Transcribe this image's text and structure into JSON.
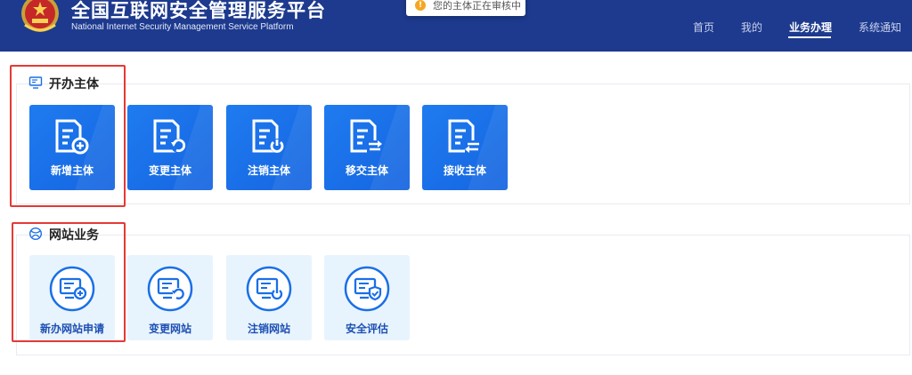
{
  "header": {
    "title": "全国互联网安全管理服务平台",
    "subtitle": "National Internet Security Management Service Platform",
    "toast": "您的主体正在审核中",
    "toast_icon": "info-icon",
    "nav": [
      {
        "label": "首页",
        "active": false
      },
      {
        "label": "我的",
        "active": false
      },
      {
        "label": "业务办理",
        "active": true
      },
      {
        "label": "系统通知",
        "active": false
      }
    ]
  },
  "sections": {
    "entity": {
      "title": "开办主体",
      "icon": "monitor-icon",
      "tiles": [
        {
          "label": "新增主体",
          "icon": "document-add-icon"
        },
        {
          "label": "变更主体",
          "icon": "document-change-icon"
        },
        {
          "label": "注销主体",
          "icon": "document-power-icon"
        },
        {
          "label": "移交主体",
          "icon": "document-transfer-icon"
        },
        {
          "label": "接收主体",
          "icon": "document-receive-icon"
        }
      ]
    },
    "website": {
      "title": "网站业务",
      "icon": "globe-icon",
      "tiles": [
        {
          "label": "新办网站申请",
          "icon": "website-add-icon"
        },
        {
          "label": "变更网站",
          "icon": "website-change-icon"
        },
        {
          "label": "注销网站",
          "icon": "website-power-icon"
        },
        {
          "label": "安全评估",
          "icon": "website-shield-icon"
        }
      ]
    }
  },
  "colors": {
    "header_bg": "#1d3a8e",
    "tile_blue": "#1a6fe8",
    "tile_light": "#e8f4fd",
    "annotation": "#e53935"
  }
}
